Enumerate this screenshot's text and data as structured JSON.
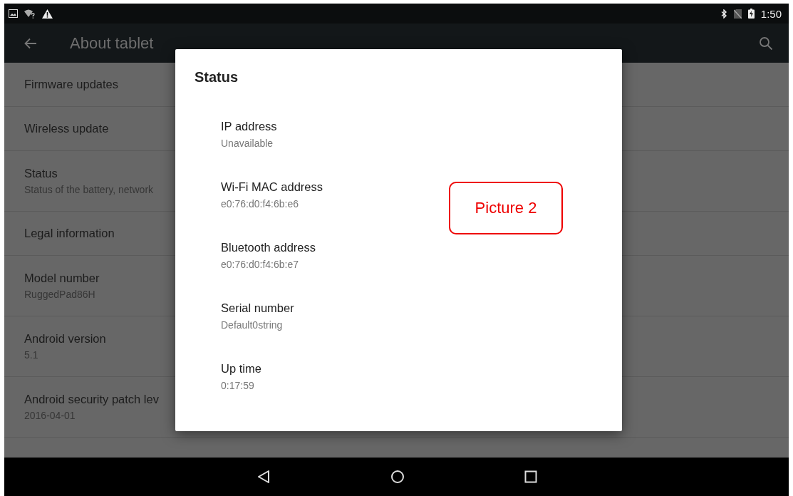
{
  "status_bar": {
    "time": "1:50"
  },
  "app_bar": {
    "title": "About tablet"
  },
  "settings_list": [
    {
      "title": "Firmware updates"
    },
    {
      "title": "Wireless update"
    },
    {
      "title": "Status",
      "summary": "Status of the battery, network"
    },
    {
      "title": "Legal information"
    },
    {
      "title": "Model number",
      "summary": "RuggedPad86H"
    },
    {
      "title": "Android version",
      "summary": "5.1"
    },
    {
      "title": "Android security patch lev",
      "summary": "2016-04-01"
    }
  ],
  "dialog": {
    "title": "Status",
    "items": [
      {
        "label": "IP address",
        "value": "Unavailable"
      },
      {
        "label": "Wi-Fi MAC address",
        "value": "e0:76:d0:f4:6b:e6"
      },
      {
        "label": "Bluetooth address",
        "value": "e0:76:d0:f4:6b:e7"
      },
      {
        "label": "Serial number",
        "value": "Default0string"
      },
      {
        "label": "Up time",
        "value": "0:17:59"
      }
    ]
  },
  "annotation": {
    "text": "Picture 2"
  }
}
